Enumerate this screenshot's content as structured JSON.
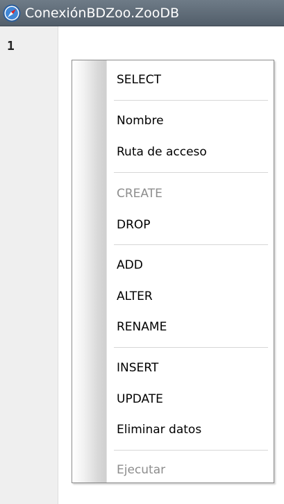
{
  "window": {
    "title": "ConexiónBDZoo.ZooDB",
    "icon": "compass-icon"
  },
  "editor": {
    "line_numbers": [
      "1"
    ]
  },
  "context_menu": {
    "items": [
      {
        "id": "select",
        "label": "SELECT",
        "enabled": true
      },
      {
        "id": "nombre",
        "label": "Nombre",
        "enabled": true
      },
      {
        "id": "ruta",
        "label": "Ruta de acceso",
        "enabled": true
      },
      {
        "id": "create",
        "label": "CREATE",
        "enabled": false
      },
      {
        "id": "drop",
        "label": "DROP",
        "enabled": true
      },
      {
        "id": "add",
        "label": "ADD",
        "enabled": true
      },
      {
        "id": "alter",
        "label": "ALTER",
        "enabled": true
      },
      {
        "id": "rename",
        "label": "RENAME",
        "enabled": true
      },
      {
        "id": "insert",
        "label": "INSERT",
        "enabled": true
      },
      {
        "id": "update",
        "label": "UPDATE",
        "enabled": true
      },
      {
        "id": "eliminar",
        "label": "Eliminar datos",
        "enabled": true
      },
      {
        "id": "ejecutar",
        "label": "Ejecutar",
        "enabled": false
      }
    ]
  },
  "colors": {
    "titlebar": "#5f6b77",
    "disabled_text": "#8d8d8d"
  }
}
